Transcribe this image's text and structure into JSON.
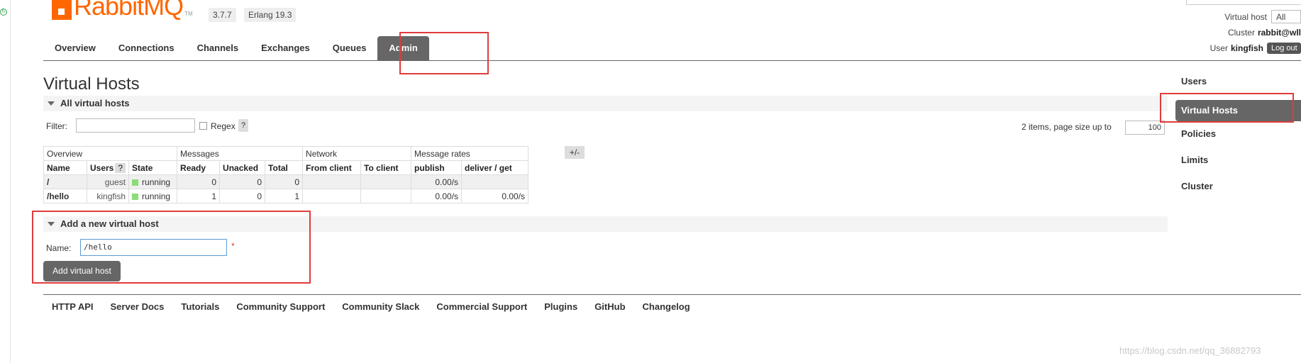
{
  "header": {
    "logo_text": "RabbitMQ",
    "logo_tm": "TM",
    "rabbitmq_version": "3.7.7",
    "erlang_version": "Erlang 19.3"
  },
  "top_right": {
    "virtual_host_label": "Virtual host",
    "virtual_host_value": "All",
    "cluster_label": "Cluster",
    "cluster_value": "rabbit@wll",
    "user_label": "User",
    "user_value": "kingfish",
    "logout_label": "Log out"
  },
  "tabs": [
    {
      "label": "Overview",
      "active": false
    },
    {
      "label": "Connections",
      "active": false
    },
    {
      "label": "Channels",
      "active": false
    },
    {
      "label": "Exchanges",
      "active": false
    },
    {
      "label": "Queues",
      "active": false
    },
    {
      "label": "Admin",
      "active": true
    }
  ],
  "page": {
    "title": "Virtual Hosts",
    "all_section_title": "All virtual hosts",
    "filter_label": "Filter:",
    "filter_value": "",
    "regex_label": "Regex",
    "help_label": "?",
    "page_size_text": "2 items, page size up to",
    "page_size_value": "100",
    "columns_toggle": "+/-"
  },
  "table": {
    "groups": [
      "Overview",
      "Messages",
      "Network",
      "Message rates"
    ],
    "columns": [
      "Name",
      "Users",
      "State",
      "Ready",
      "Unacked",
      "Total",
      "From client",
      "To client",
      "publish",
      "deliver / get"
    ],
    "rows": [
      {
        "name": "/",
        "users": "guest",
        "state": "running",
        "ready": "0",
        "unacked": "0",
        "total": "0",
        "from_client": "",
        "to_client": "",
        "publish": "0.00/s",
        "deliver_get": ""
      },
      {
        "name": "/hello",
        "users": "kingfish",
        "state": "running",
        "ready": "1",
        "unacked": "0",
        "total": "1",
        "from_client": "",
        "to_client": "",
        "publish": "0.00/s",
        "deliver_get": "0.00/s"
      }
    ]
  },
  "add_form": {
    "section_title": "Add a new virtual host",
    "name_label": "Name:",
    "name_value": "/hello",
    "required_mark": "*",
    "submit_label": "Add virtual host"
  },
  "footer": {
    "links": [
      "HTTP API",
      "Server Docs",
      "Tutorials",
      "Community Support",
      "Community Slack",
      "Commercial Support",
      "Plugins",
      "GitHub",
      "Changelog"
    ]
  },
  "sidebar": {
    "items": [
      {
        "label": "Users",
        "active": false
      },
      {
        "label": "Virtual Hosts",
        "active": true
      },
      {
        "label": "Policies",
        "active": false
      },
      {
        "label": "Limits",
        "active": false
      },
      {
        "label": "Cluster",
        "active": false
      }
    ]
  },
  "watermark": "https://blog.csdn.net/qq_36882793",
  "colors": {
    "brand": "#ff6600",
    "tab_active": "#666666",
    "highlight_box": "#e03c3c",
    "state_running": "#8bde75"
  }
}
